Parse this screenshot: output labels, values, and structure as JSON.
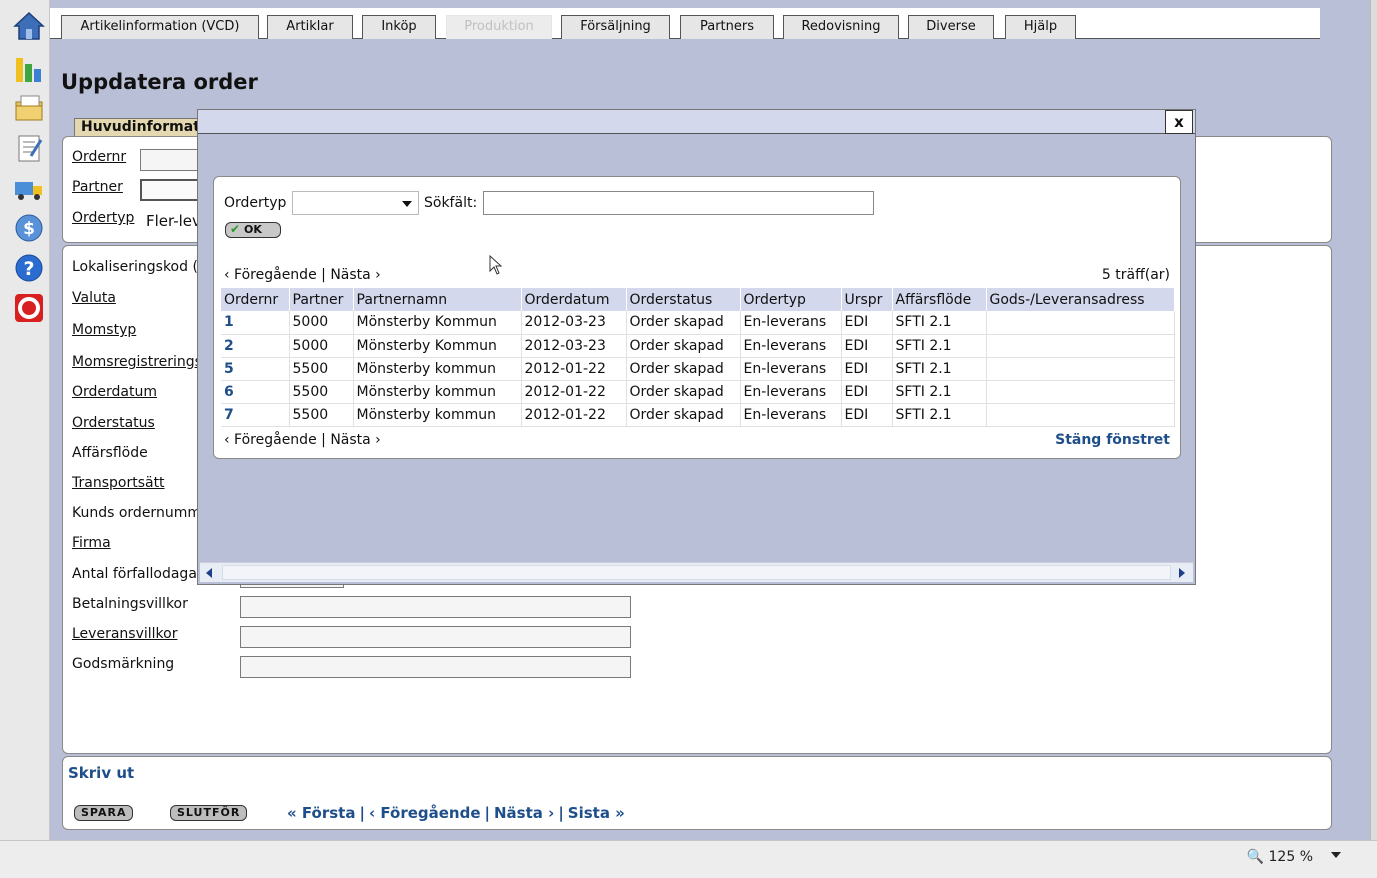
{
  "topnav": {
    "tabs": [
      {
        "label": "Artikelinformation (VCD)",
        "disabled": false
      },
      {
        "label": "Artiklar",
        "disabled": false
      },
      {
        "label": "Inköp",
        "disabled": false
      },
      {
        "label": "Produktion",
        "disabled": true
      },
      {
        "label": "Försäljning",
        "disabled": false
      },
      {
        "label": "Partners",
        "disabled": false
      },
      {
        "label": "Redovisning",
        "disabled": false
      },
      {
        "label": "Diverse",
        "disabled": false
      },
      {
        "label": "Hjälp",
        "disabled": false
      }
    ]
  },
  "page": {
    "title": "Uppdatera order",
    "subtab": "Huvudinformation"
  },
  "form": {
    "ordernr_label": "Ordernr",
    "partner_label": "Partner",
    "ordertyp_label": "Ordertyp",
    "ordertyp_value": "Fler-leverans",
    "lokaliseringskod_label": "Lokaliseringskod (",
    "valuta_label": "Valuta",
    "momstyp_label": "Momstyp",
    "momsreg_label": "Momsregistreringsnummer",
    "orderdatum_label": "Orderdatum",
    "orderstatus_label": "Orderstatus",
    "affarsflode_label": "Affärsflöde",
    "transportsatt_label": "Transportsätt",
    "kunds_ordernummer_label": "Kunds ordernummer",
    "firma_label": "Firma",
    "antal_forfallodagar_label": "Antal förfallodagar",
    "betalningsvillkor_label": "Betalningsvillkor",
    "leveransvillkor_label": "Leveransvillkor",
    "godsmarkning_label": "Godsmärkning"
  },
  "footer": {
    "skriv_ut": "Skriv ut",
    "spara": "SPARA",
    "slutfor": "SLUTFÖR",
    "first": "« Första",
    "prev": "‹ Föregående",
    "next": "Nästa ›",
    "last": "Sista »"
  },
  "modal": {
    "close_label": "x",
    "ordertyp_label": "Ordertyp",
    "ordertyp_value": "",
    "sokfalt_label": "Sökfält:",
    "sokfalt_value": "",
    "ok_label": "OK",
    "pager_prev": "‹ Föregående",
    "pager_sep": "|",
    "pager_next": "Nästa ›",
    "hits": "5 träff(ar)",
    "close_window": "Stäng fönstret",
    "columns": [
      "Ordernr",
      "Partner",
      "Partnernamn",
      "Orderdatum",
      "Orderstatus",
      "Ordertyp",
      "Urspr",
      "Affärsflöde",
      "Gods-/Leveransadress"
    ],
    "rows": [
      [
        "1",
        "5000",
        "Mönsterby Kommun",
        "2012-03-23",
        "Order skapad",
        "En-leverans",
        "EDI",
        "SFTI 2.1",
        ""
      ],
      [
        "2",
        "5000",
        "Mönsterby Kommun",
        "2012-03-23",
        "Order skapad",
        "En-leverans",
        "EDI",
        "SFTI 2.1",
        ""
      ],
      [
        "5",
        "5500",
        "Mönsterby kommun",
        "2012-01-22",
        "Order skapad",
        "En-leverans",
        "EDI",
        "SFTI 2.1",
        ""
      ],
      [
        "6",
        "5500",
        "Mönsterby kommun",
        "2012-01-22",
        "Order skapad",
        "En-leverans",
        "EDI",
        "SFTI 2.1",
        ""
      ],
      [
        "7",
        "5500",
        "Mönsterby kommun",
        "2012-01-22",
        "Order skapad",
        "En-leverans",
        "EDI",
        "SFTI 2.1",
        ""
      ]
    ]
  },
  "statusbar": {
    "zoom": "125 %"
  },
  "colors": {
    "background": "#b8bfd6",
    "header_blue": "#d3d8ec",
    "link_blue": "#1f4f8a",
    "tab_active_bg": "#e4d8b0"
  },
  "icons": [
    "home-icon",
    "chart-icon",
    "folder-icon",
    "document-icon",
    "truck-icon",
    "dollar-icon",
    "help-icon",
    "lifebuoy-icon",
    "zoom-icon",
    "cursor-icon"
  ]
}
